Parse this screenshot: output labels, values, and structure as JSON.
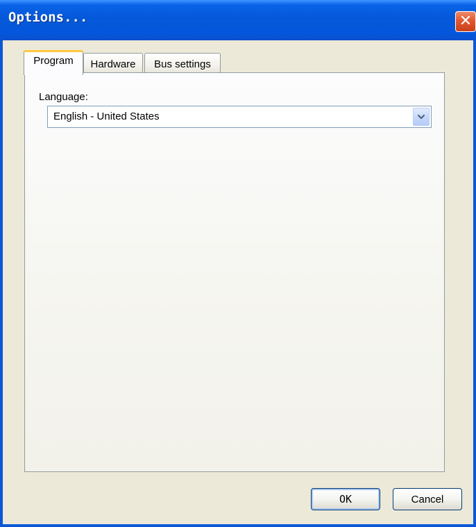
{
  "window": {
    "title": "Options...",
    "close_glyph": "✕"
  },
  "tabs": [
    {
      "label": "Program",
      "active": true
    },
    {
      "label": "Hardware",
      "active": false
    },
    {
      "label": "Bus settings",
      "active": false
    }
  ],
  "program": {
    "language_label": "Language:",
    "language_value": "English - United States"
  },
  "buttons": {
    "ok_label": "OK",
    "cancel_label": "Cancel"
  },
  "colors": {
    "titlebar": "#0458d8",
    "active_tab_accent": "#ffc83c",
    "close_button": "#e2572f",
    "dialog_face": "#ece9d8"
  },
  "icons": {
    "close": "close-icon",
    "dropdown": "chevron-down-icon"
  }
}
